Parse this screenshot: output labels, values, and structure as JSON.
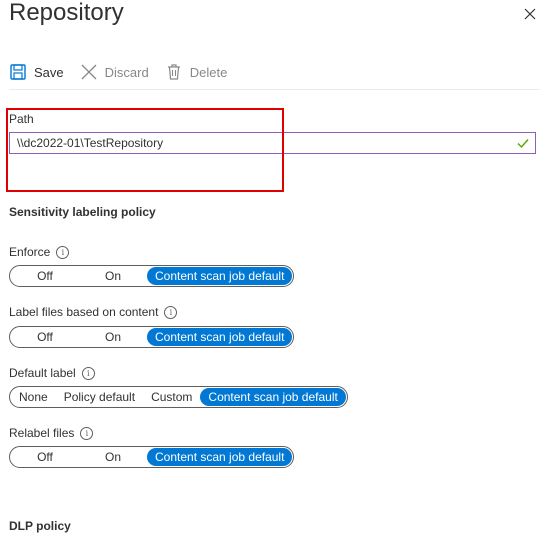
{
  "panel": {
    "title": "Repository"
  },
  "toolbar": {
    "save_label": "Save",
    "discard_label": "Discard",
    "delete_label": "Delete"
  },
  "path": {
    "label": "Path",
    "value": "\\\\dc2022-01\\TestRepository"
  },
  "sections": {
    "sensitivity_title": "Sensitivity labeling policy",
    "dlp_title": "DLP policy"
  },
  "fields": {
    "enforce": {
      "label": "Enforce",
      "options": [
        "Off",
        "On",
        "Content scan job default"
      ],
      "selected": "Content scan job default"
    },
    "label_files": {
      "label": "Label files based on content",
      "options": [
        "Off",
        "On",
        "Content scan job default"
      ],
      "selected": "Content scan job default"
    },
    "default_label": {
      "label": "Default label",
      "options": [
        "None",
        "Policy default",
        "Custom",
        "Content scan job default"
      ],
      "selected": "Content scan job default"
    },
    "relabel_files": {
      "label": "Relabel files",
      "options": [
        "Off",
        "On",
        "Content scan job default"
      ],
      "selected": "Content scan job default"
    }
  },
  "colors": {
    "accent": "#0078d4",
    "highlight": "#e00000",
    "input_border": "#8f5fb8",
    "valid_check": "#57a300"
  }
}
